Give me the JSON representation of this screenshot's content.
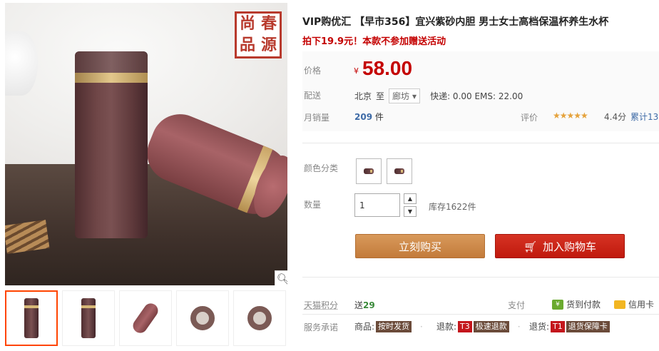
{
  "product": {
    "title": "VIP购优汇 【早市356】宜兴紫砂内胆 男士女士高档保温杯养生水杯",
    "promo": "拍下19.9元！本款不参加赠送活动",
    "seal_chars": [
      "尚",
      "春",
      "品",
      "源"
    ]
  },
  "gallery": {
    "zoom_icon": "magnifier-icon",
    "thumbnail_count": 5
  },
  "price": {
    "label": "价格",
    "currency": "¥",
    "value": "58.00"
  },
  "shipping": {
    "label": "配送",
    "from": "北京",
    "to_word": "至",
    "destination": "廊坊",
    "fee": "快递: 0.00 EMS: 22.00"
  },
  "sales": {
    "label": "月销量",
    "count": "209",
    "unit": "件",
    "rating_label": "评价",
    "stars": "★★★★★",
    "score": "4.4分",
    "cumulative": "累计13"
  },
  "options": {
    "color_label": "颜色分类",
    "qty_label": "数量",
    "qty_value": "1",
    "stock": "库存1622件"
  },
  "actions": {
    "buy_now": "立刻购买",
    "add_cart": "加入购物车"
  },
  "points": {
    "label": "天猫积分",
    "prefix": "送",
    "value": "29",
    "pay_label": "支付",
    "pay_cod": "货到付款",
    "pay_credit": "信用卡"
  },
  "service": {
    "label": "服务承诺",
    "goods_prefix": "商品:",
    "goods_tag": "按时发货",
    "refund_prefix": "退款:",
    "refund_code": "T3",
    "refund_tag": "极速退款",
    "return_prefix": "退货:",
    "return_code": "T1",
    "return_tag": "退货保障卡"
  }
}
